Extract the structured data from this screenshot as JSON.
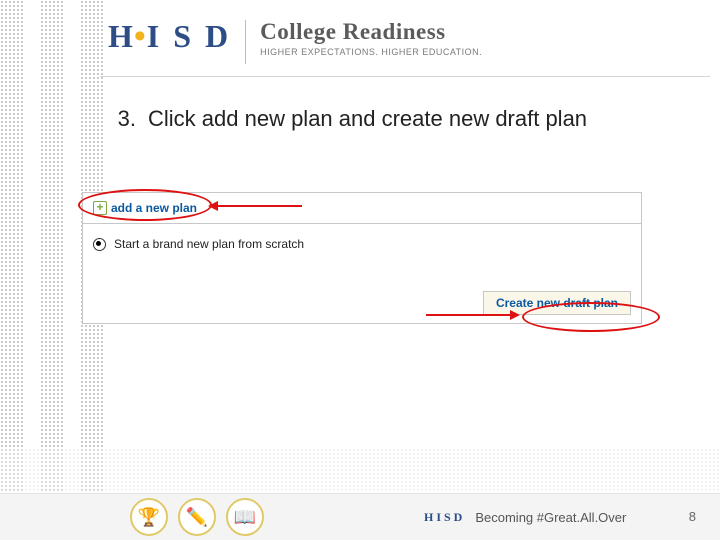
{
  "header": {
    "brand": "HISD",
    "title": "College Readiness",
    "tagline": "HIGHER EXPECTATIONS. HIGHER EDUCATION."
  },
  "instruction": {
    "number": "3.",
    "text": "Click add new plan and create new draft plan"
  },
  "screenshot": {
    "add_link": "add a new plan",
    "radio_label": "Start a brand new plan from scratch",
    "create_button": "Create new draft plan"
  },
  "footer": {
    "brand": "HISD",
    "motto": "Becoming #Great.All.Over",
    "page": "8"
  }
}
